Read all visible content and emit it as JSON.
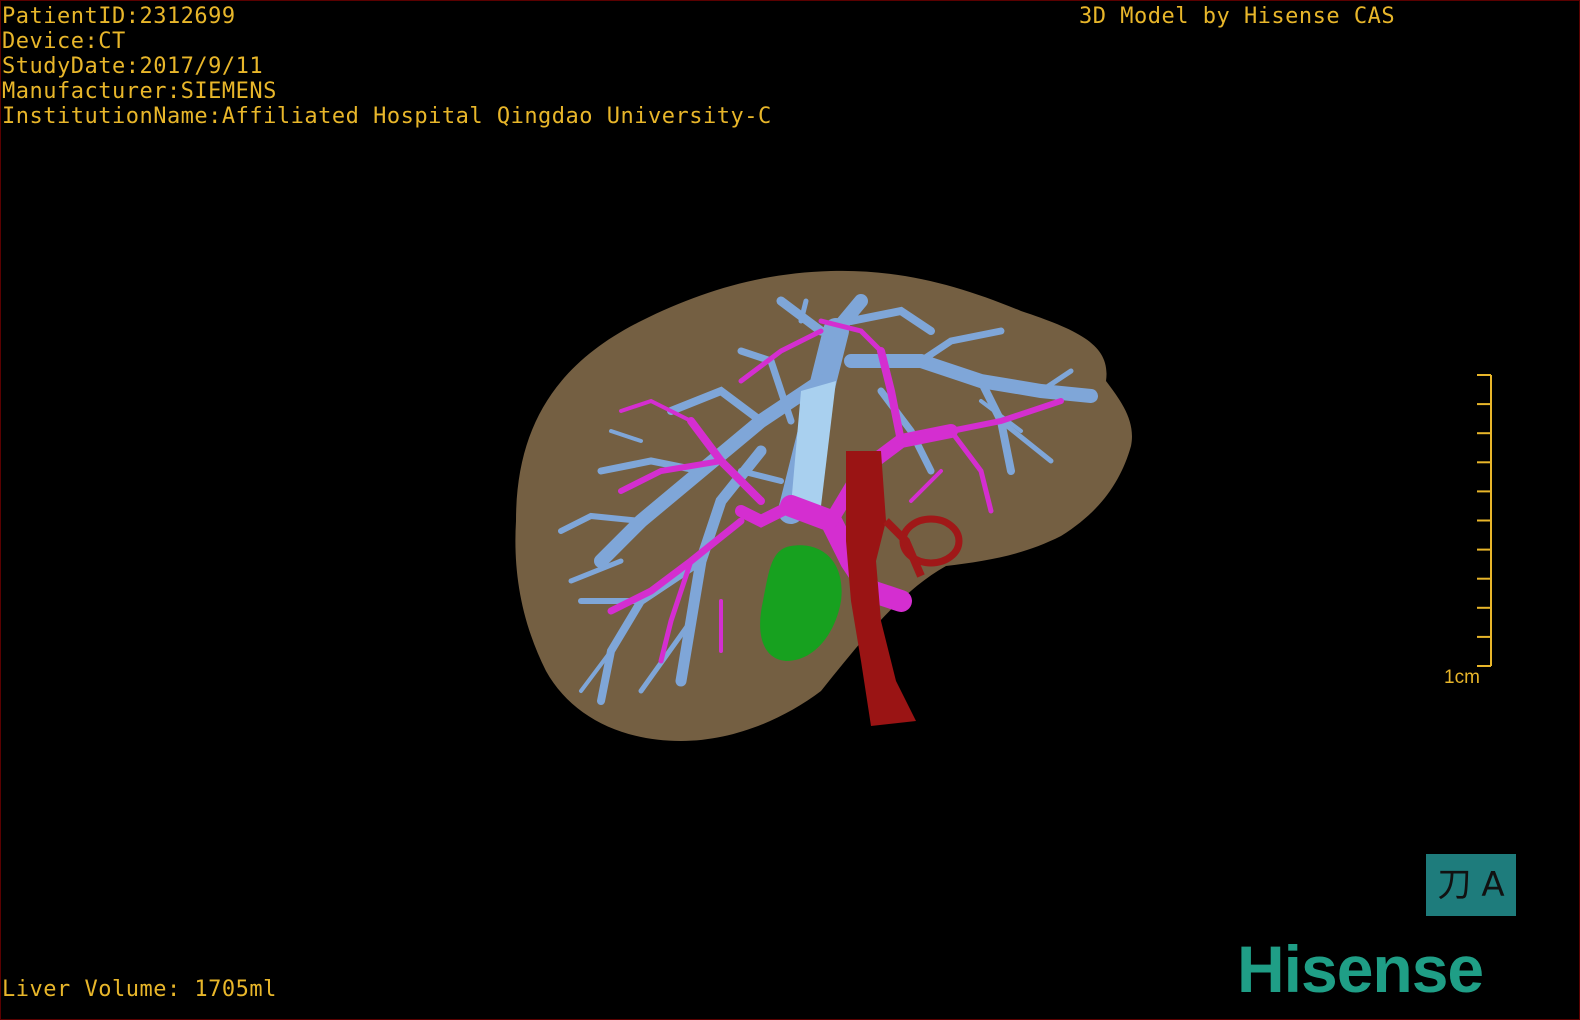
{
  "patient_info": [
    "PatientID:2312699",
    "Device:CT",
    "StudyDate:2017/9/11",
    "Manufacturer:SIEMENS",
    "InstitutionName:Affiliated Hospital Qingdao University-C"
  ],
  "credit": "3D Model by Hisense CAS",
  "liver_volume": "Liver Volume: 1705ml",
  "scale_bar": {
    "label": "1cm",
    "ticks": 10
  },
  "view_toggle": {
    "left_icon": "刀",
    "right_icon": "A",
    "icon_names": [
      "knife-icon",
      "anterior-view-icon"
    ]
  },
  "brand": {
    "text": "Hisense",
    "color": "#1f9e86"
  },
  "colors": {
    "text": "#e8b62a",
    "liver": "#7a6446",
    "hepatic_vein": "#7fa6d8",
    "portal_vein": "#d42ed0",
    "gallbladder": "#17a11f",
    "artery": "#9a1414",
    "border": "#5a0000"
  }
}
